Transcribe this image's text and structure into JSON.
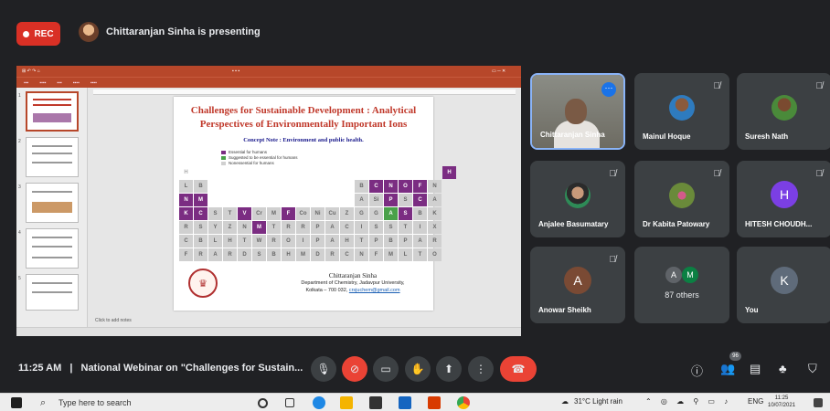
{
  "meet": {
    "rec_label": "REC",
    "presenter_text": "Chittaranjan Sinha is presenting",
    "time": "11:25 AM",
    "separator": "|",
    "meeting_title": "National Webinar on \"Challenges for Sustain...",
    "people_count": "96"
  },
  "slide": {
    "title": "Challenges for Sustainable Development : Analytical Perspectives of Environmentally Important Ions",
    "concept_note": "Concept Note : Environment and public health.",
    "legend": [
      "Essential for humans",
      "Suggested to be essential for humans",
      "Nonessential for humans"
    ],
    "author_name": "Chittaranjan Sinha",
    "author_dept": "Department of Chemistry, Jadavpur University,",
    "author_addr": "Kolkata – 700 032,",
    "author_email": "crsjuchem@gmail.com",
    "notes_placeholder": "Click to add notes"
  },
  "participants": [
    {
      "name": "Chittaranjan Sinha"
    },
    {
      "name": "Mainul Hoque"
    },
    {
      "name": "Suresh Nath"
    },
    {
      "name": "Anjalee Basumatary"
    },
    {
      "name": "Dr Kabita Patowary"
    },
    {
      "name": "HITESH CHOUDH...",
      "initial": "H"
    },
    {
      "name": "Anowar Sheikh",
      "initial": "A"
    },
    {
      "name": "87 others",
      "initials": [
        "A",
        "M"
      ]
    },
    {
      "name": "You",
      "initial": "K"
    }
  ],
  "taskbar": {
    "search_placeholder": "Type here to search",
    "weather": "31°C  Light rain",
    "lang": "ENG",
    "clock_time": "11:25",
    "clock_date": "10/07/2021"
  },
  "colors": {
    "accent": "#1a73e8",
    "red": "#ea4335",
    "tile_bg": "#3c4043",
    "bg": "#202124",
    "ppt": "#b7472a"
  }
}
